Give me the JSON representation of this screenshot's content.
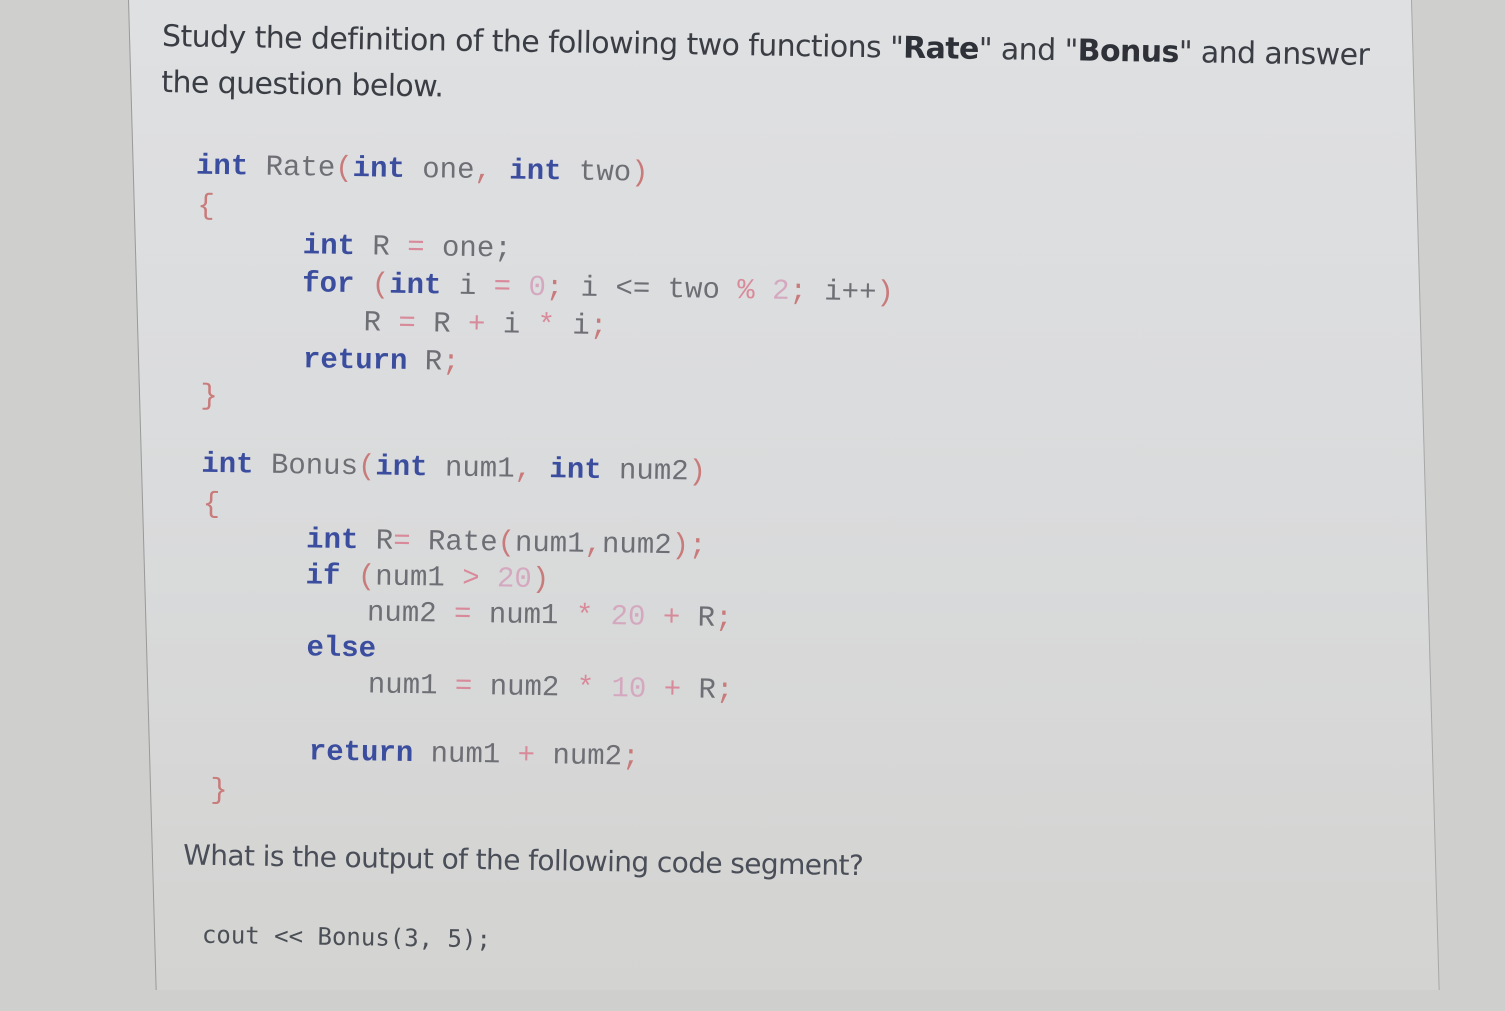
{
  "intro": {
    "prefix": "Study the definition of the following two functions \"",
    "func1": "Rate",
    "middle": "\" and \"",
    "func2": "Bonus",
    "suffix": "\" and answer the question below."
  },
  "rate_function": {
    "signature": {
      "ret": "int",
      "name": "Rate",
      "p1_type": "int",
      "p1_name": "one",
      "p2_type": "int",
      "p2_name": "two"
    },
    "open_brace": "{",
    "lines": {
      "decl_kw": "int",
      "decl_rest": " R ",
      "decl_eq": "=",
      "decl_val": " one;",
      "for_kw": "for",
      "for_open": " (",
      "for_int": "int",
      "for_i": " i ",
      "for_eq": "=",
      "for_zero": " 0",
      "for_semi1": ";",
      "for_cond": " i <= two ",
      "for_mod": "%",
      "for_two": " 2",
      "for_semi2": ";",
      "for_inc": " i++",
      "for_close": ")",
      "body_r": "R ",
      "body_eq": "=",
      "body_r2": " R ",
      "body_plus": "+",
      "body_i": " i ",
      "body_star": "*",
      "body_i2": " i",
      "body_semi": ";",
      "return_kw": "return",
      "return_val": " R",
      "return_semi": ";"
    },
    "close_brace": "}"
  },
  "bonus_function": {
    "signature": {
      "ret": "int",
      "name": "Bonus",
      "p1_type": "int",
      "p1_name": "num1",
      "p2_type": "int",
      "p2_name": "num2"
    },
    "open_brace": "{",
    "lines": {
      "decl_kw": "int",
      "decl_r": " R",
      "decl_eq": "=",
      "decl_call": " Rate",
      "decl_args_open": "(",
      "decl_args": "num1",
      "decl_comma": ",",
      "decl_args2": "num2",
      "decl_args_close": ")",
      "decl_semi": ";",
      "if_kw": "if",
      "if_open": " (",
      "if_var": "num1 ",
      "if_gt": ">",
      "if_val": " 20",
      "if_close": ")",
      "then_lhs": "num2 ",
      "then_eq": "=",
      "then_rhs": " num1 ",
      "then_star": "*",
      "then_num": " 20 ",
      "then_plus": "+",
      "then_r": " R",
      "then_semi": ";",
      "else_kw": "else",
      "else_lhs": "num1 ",
      "else_eq": "=",
      "else_rhs": " num2 ",
      "else_star": "*",
      "else_num": " 10 ",
      "else_plus": "+",
      "else_r": " R",
      "else_semi": ";",
      "return_kw": "return",
      "return_a": " num1 ",
      "return_plus": "+",
      "return_b": " num2",
      "return_semi": ";"
    },
    "close_brace": "}"
  },
  "question": "What is the output of the following code segment?",
  "snippet": "cout << Bonus(3, 5);"
}
